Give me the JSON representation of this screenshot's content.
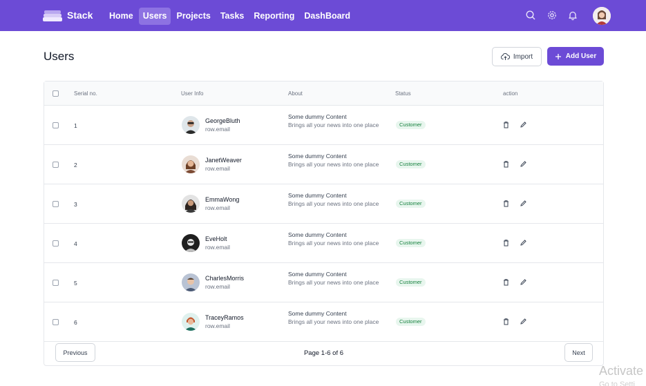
{
  "app": {
    "brand": "Stack"
  },
  "nav": {
    "items": [
      {
        "label": "Home",
        "active": false
      },
      {
        "label": "Users",
        "active": true
      },
      {
        "label": "Projects",
        "active": false
      },
      {
        "label": "Tasks",
        "active": false
      },
      {
        "label": "Reporting",
        "active": false
      },
      {
        "label": "DashBoard",
        "active": false
      }
    ],
    "icons": [
      "search-icon",
      "gear-icon",
      "bell-icon"
    ]
  },
  "page": {
    "title": "Users",
    "import_label": "Import",
    "add_label": "Add User"
  },
  "table": {
    "headers": {
      "serial": "Serial no.",
      "user_info": "User Info",
      "about": "About",
      "status": "Status",
      "action": "action"
    },
    "rows": [
      {
        "serial": "1",
        "name": "GeorgeBluth",
        "email": "row.email",
        "about_title": "Some dummy Content",
        "about_desc": "Brings all your news into one place",
        "status": "Customer"
      },
      {
        "serial": "2",
        "name": "JanetWeaver",
        "email": "row.email",
        "about_title": "Some dummy Content",
        "about_desc": "Brings all your news into one place",
        "status": "Customer"
      },
      {
        "serial": "3",
        "name": "EmmaWong",
        "email": "row.email",
        "about_title": "Some dummy Content",
        "about_desc": "Brings all your news into one place",
        "status": "Customer"
      },
      {
        "serial": "4",
        "name": "EveHolt",
        "email": "row.email",
        "about_title": "Some dummy Content",
        "about_desc": "Brings all your news into one place",
        "status": "Customer"
      },
      {
        "serial": "5",
        "name": "CharlesMorris",
        "email": "row.email",
        "about_title": "Some dummy Content",
        "about_desc": "Brings all your news into one place",
        "status": "Customer"
      },
      {
        "serial": "6",
        "name": "TraceyRamos",
        "email": "row.email",
        "about_title": "Some dummy Content",
        "about_desc": "Brings all your news into one place",
        "status": "Customer"
      }
    ]
  },
  "pagination": {
    "previous_label": "Previous",
    "next_label": "Next",
    "page_text": "Page 1-6 of 6"
  },
  "watermark": {
    "line1": "Activate",
    "line2": "Go to Setti"
  },
  "colors": {
    "brand": "#6c4bd6",
    "nav_active": "#8d72e2",
    "status_text": "#15803d",
    "status_bg": "#e8f6ee"
  }
}
